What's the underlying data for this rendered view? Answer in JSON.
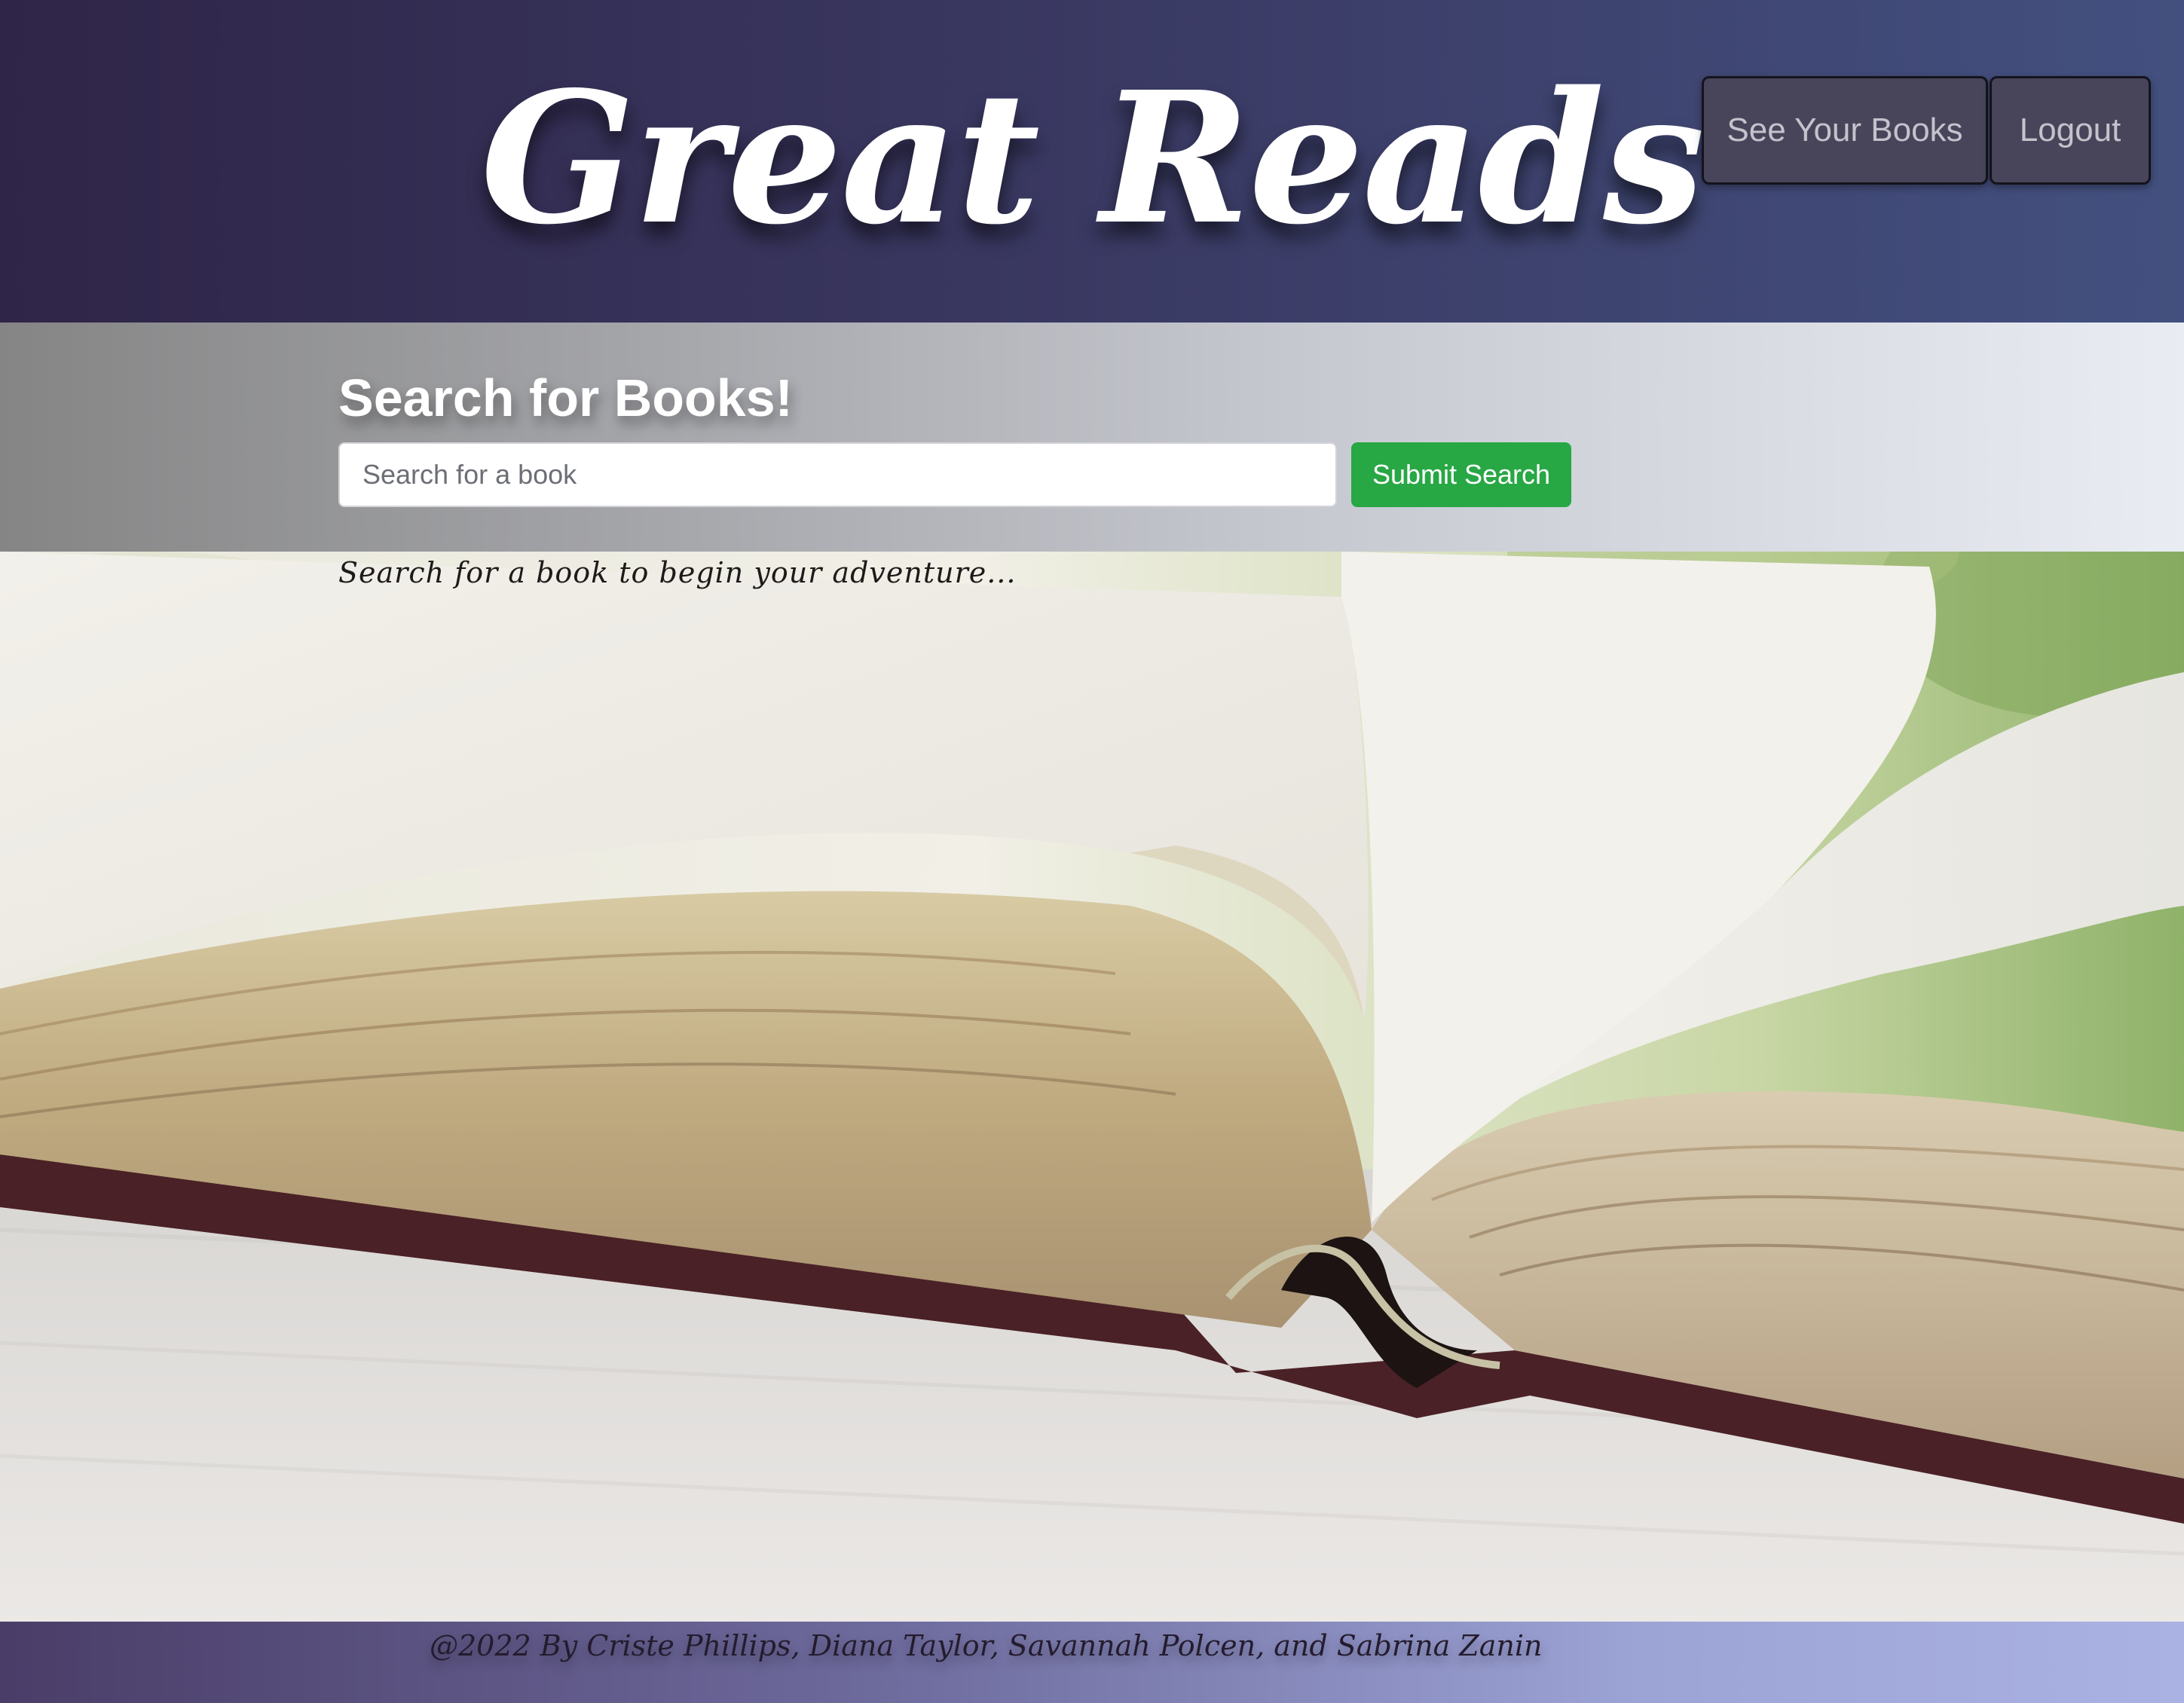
{
  "header": {
    "title": "Great Reads",
    "nav": {
      "see_books_label": "See Your Books",
      "logout_label": "Logout"
    }
  },
  "search": {
    "heading": "Search for Books!",
    "placeholder": "Search for a book",
    "value": "",
    "submit_label": "Submit Search"
  },
  "main": {
    "prompt": "Search for a book to begin your adventure...",
    "background_image": "open-book-photo"
  },
  "footer": {
    "credits": "@2022 By Criste Phillips, Diana Taylor, Savannah Polcen, and Sabrina Zanin"
  },
  "colors": {
    "header_gradient_start": "#2f2548",
    "header_gradient_end": "#43507f",
    "submit_button": "#28a745",
    "nav_button": "#48455a"
  }
}
